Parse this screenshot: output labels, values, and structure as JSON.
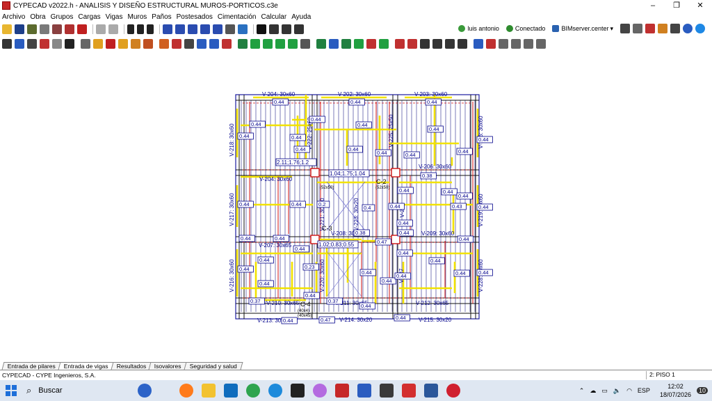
{
  "window": {
    "title": "CYPECAD v2022.h - ANALISIS Y DISEÑO ESTRUCTURAL MUROS-PORTICOS.c3e",
    "min": "–",
    "max": "❐",
    "close": "✕"
  },
  "menu": [
    "Archivo",
    "Obra",
    "Grupos",
    "Cargas",
    "Vigas",
    "Muros",
    "Paños",
    "Postesados",
    "Cimentación",
    "Calcular",
    "Ayuda"
  ],
  "toolbar_status": {
    "user": "luis antonio",
    "connection": "Conectado",
    "server": "BIMserver.center"
  },
  "plan": {
    "beams_top": [
      "V-204: 30x60",
      "V-202: 30x60",
      "V-203: 30x60"
    ],
    "beams_mid1": [
      "V-204: 30x60",
      "V-206: 30x60"
    ],
    "beams_mid2": [
      "V-207: 30x65",
      "V-208: 30x65",
      "V-209: 30x60"
    ],
    "beams_low": [
      "V-210: 30x65",
      "V-211: 30x65",
      "V-212: 30x65"
    ],
    "beams_bottom": [
      "V-213: 30x20",
      "V-214: 30x20",
      "V-215: 30x20"
    ],
    "beams_vertical": [
      "V-218: 30x60",
      "V-222: 25x60",
      "V-225: 25x50",
      "V-226: 30x60",
      "V-217: 30x60",
      "V-221: 30x60",
      "V-223: 30x20",
      "V-224",
      "V-219: 30x60",
      "V-216: 30x60",
      "V-220: 30x60",
      "V-227",
      "V-228: 30x60"
    ],
    "columns": [
      "C-2",
      "C-3",
      "C-4"
    ],
    "column_sizes": [
      "(52x50)",
      "(52x50)",
      "(40x4)",
      "(40x45)"
    ],
    "zone_labels": [
      "2.11;1.76;1.2",
      "1.04;1.75;1.04",
      "1.02;0.83;0.55"
    ],
    "values": [
      "0.44",
      "0.4",
      "0.23",
      "0.37",
      "0.47",
      "0.38",
      "0.43",
      "0.2"
    ]
  },
  "tabs": [
    "Entrada de pilares",
    "Entrada de vigas",
    "Resultados",
    "Isovalores",
    "Seguridad y salud"
  ],
  "active_tab": "Entrada de vigas",
  "status": {
    "company": "CYPECAD - CYPE Ingenieros, S.A.",
    "floor": "2: PISO 1"
  },
  "taskbar": {
    "search_placeholder": "Buscar",
    "lang": "ESP",
    "time": "12:02",
    "date": "18/07/2026",
    "notif": "10"
  }
}
